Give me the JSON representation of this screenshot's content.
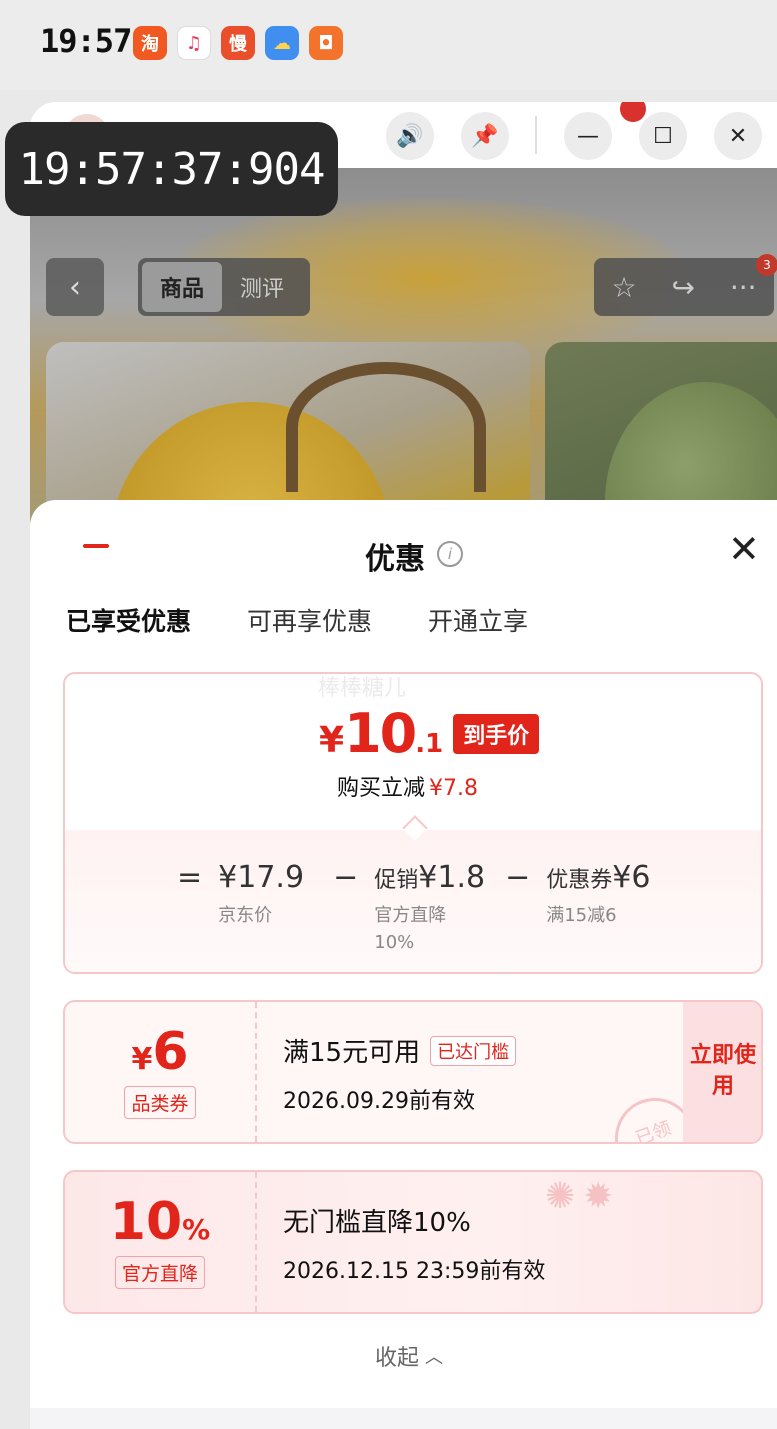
{
  "status_bar": {
    "time": "19:57",
    "apps": [
      {
        "icon": "taobao-icon",
        "glyph": "淘",
        "color": "#f05a22"
      },
      {
        "icon": "music-icon",
        "glyph": "♫",
        "color": "#ffffff"
      },
      {
        "icon": "manhua-icon",
        "glyph": "慢",
        "color": "#ea4f2b"
      },
      {
        "icon": "weather-icon",
        "glyph": "☁",
        "color": "#3f8ef0"
      },
      {
        "icon": "redpacket-icon",
        "glyph": "◘",
        "color": "#f4732c"
      }
    ]
  },
  "overlay_timestamp": "19:57:37:904",
  "window_controls": {
    "sound": "🔊",
    "pin": "📌",
    "minimize": "—",
    "maximize": "☐",
    "close": "✕"
  },
  "product_nav": {
    "back": "‹",
    "segments": [
      "商品",
      "测评"
    ],
    "active_segment": 0,
    "star": "☆",
    "share": "↪",
    "more": "···",
    "badge": "3"
  },
  "sheet": {
    "title": "优惠",
    "info": "i",
    "close": "✕",
    "tabs": [
      "已享受优惠",
      "可再享优惠",
      "开通立享"
    ],
    "active_tab": 0,
    "watermark": "棒棒糖儿"
  },
  "summary": {
    "currency": "¥",
    "price_int": "10",
    "price_dec": ".1",
    "price_tag": "到手价",
    "save_label": "购买立减",
    "save_amount": "¥7.8",
    "equals": "=",
    "minus": "−",
    "items": [
      {
        "value_prefix": "",
        "value": "¥17.9",
        "sub": "京东价"
      },
      {
        "value_prefix": "促销",
        "value": "¥1.8",
        "sub": "官方直降10%"
      },
      {
        "value_prefix": "优惠券",
        "value": "¥6",
        "sub": "满15减6"
      }
    ]
  },
  "coupons": [
    {
      "symbol": "¥",
      "amount": "6",
      "label": "品类券",
      "title": "满15元可用",
      "badge": "已达门槛",
      "date": "2026.09.29前有效",
      "action": "立即使用",
      "stamp": "已领"
    },
    {
      "amount": "10",
      "pct": "%",
      "label": "官方直降",
      "title": "无门槛直降10%",
      "date": "2026.12.15 23:59前有效"
    }
  ],
  "collapse_label": "收起",
  "colors": {
    "accent": "#e1251b",
    "border_pink": "#f6c7c9"
  }
}
